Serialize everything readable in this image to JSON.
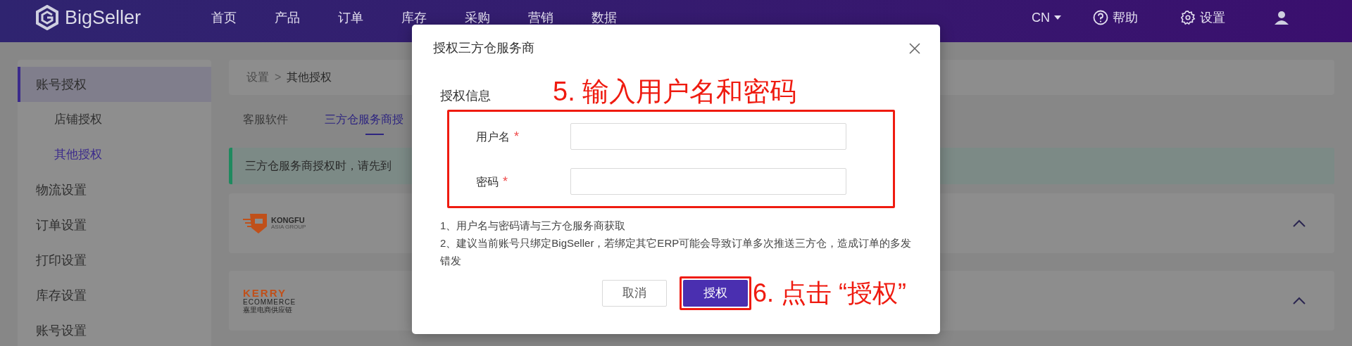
{
  "header": {
    "logo": "BigSeller",
    "nav": [
      {
        "label": "首页",
        "selected": false
      },
      {
        "label": "产品",
        "selected": false
      },
      {
        "label": "订单",
        "selected": false
      },
      {
        "label": "库存",
        "selected": false
      },
      {
        "label": "采购",
        "selected": false
      },
      {
        "label": "营销",
        "selected": false
      },
      {
        "label": "数据",
        "selected": false
      }
    ],
    "language": "CN",
    "help": "帮助",
    "settings": "设置"
  },
  "sidebar": {
    "items": [
      {
        "label": "账号授权",
        "selected": true,
        "children": [
          {
            "label": "店铺授权",
            "selected": false
          },
          {
            "label": "其他授权",
            "selected": true
          }
        ]
      },
      {
        "label": "物流设置",
        "selected": false
      },
      {
        "label": "订单设置",
        "selected": false
      },
      {
        "label": "打印设置",
        "selected": false
      },
      {
        "label": "库存设置",
        "selected": false
      },
      {
        "label": "账号设置",
        "selected": false
      }
    ]
  },
  "breadcrumb": {
    "items": [
      "设置",
      "其他授权"
    ],
    "separator": ">"
  },
  "tabs": [
    {
      "label": "客服软件",
      "selected": false
    },
    {
      "label": "三方仓服务商授",
      "selected": true
    }
  ],
  "alert": "三方仓服务商授权时，请先到",
  "providers": [
    {
      "kind": "kongfu",
      "name": "KONGFU",
      "subtitle": "ASIA GROUP",
      "expanded": true
    },
    {
      "kind": "kerry",
      "name": "KERRY",
      "subtitle": "ECOMMERCE",
      "subtitle_cn": "嘉里电商供应链",
      "expanded": true
    }
  ],
  "dialog": {
    "title": "授权三方仓服务商",
    "required_mark": "*",
    "section": "授权信息",
    "fields": [
      {
        "label": "用户名",
        "required": true
      },
      {
        "label": "密码",
        "required": true
      }
    ],
    "notes": [
      "1、用户名与密码请与三方仓服务商获取",
      "2、建议当前账号只绑定BigSeller，若绑定其它ERP可能会导致订单多次推送三方仓，造成订单的多发错发"
    ],
    "buttons": [
      {
        "label": "取消",
        "kind": "secondary"
      },
      {
        "label": "授权",
        "kind": "primary"
      }
    ]
  },
  "annotations": [
    "5. 输入用户名和密码",
    "6. 点击 “授权”"
  ]
}
